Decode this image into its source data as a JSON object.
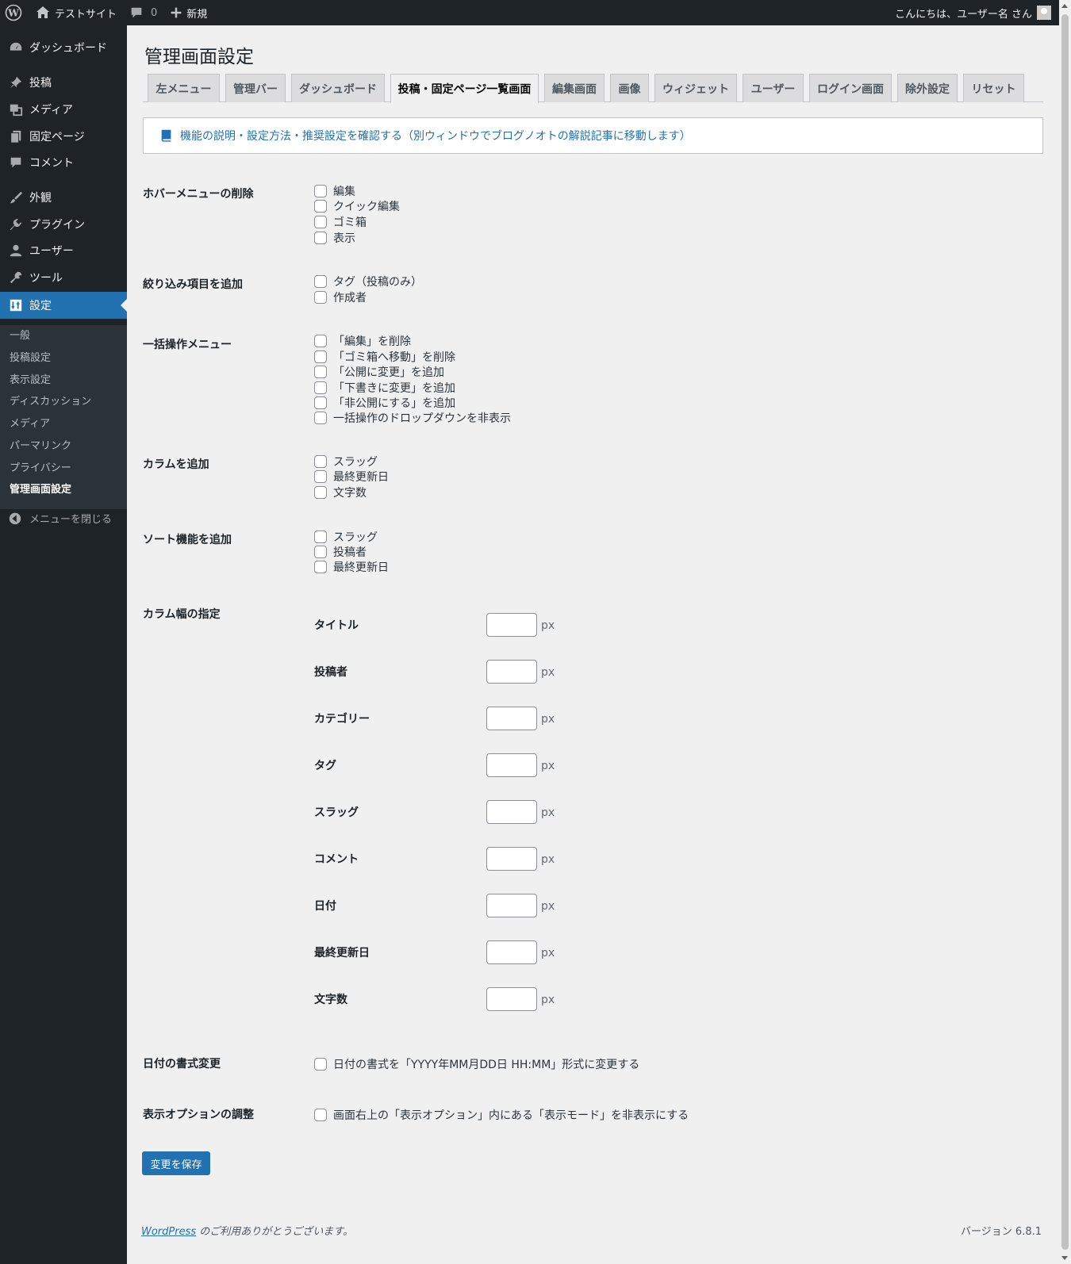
{
  "admin_bar": {
    "site_name": "テストサイト",
    "comments_count": "0",
    "new_label": "新規",
    "greeting": "こんにちは、ユーザー名 さん"
  },
  "sidebar": {
    "items": [
      {
        "label": "ダッシュボード",
        "icon": "dashboard-icon"
      },
      {
        "label": "投稿",
        "icon": "pin-icon"
      },
      {
        "label": "メディア",
        "icon": "media-icon"
      },
      {
        "label": "固定ページ",
        "icon": "page-icon"
      },
      {
        "label": "コメント",
        "icon": "comment-icon"
      },
      {
        "label": "外観",
        "icon": "brush-icon"
      },
      {
        "label": "プラグイン",
        "icon": "plugin-icon"
      },
      {
        "label": "ユーザー",
        "icon": "user-icon"
      },
      {
        "label": "ツール",
        "icon": "wrench-icon"
      },
      {
        "label": "設定",
        "icon": "settings-icon"
      }
    ],
    "submenu": [
      "一般",
      "投稿設定",
      "表示設定",
      "ディスカッション",
      "メディア",
      "パーマリンク",
      "プライバシー",
      "管理画面設定"
    ],
    "collapse_label": "メニューを閉じる"
  },
  "page": {
    "title": "管理画面設定",
    "tabs": [
      "左メニュー",
      "管理バー",
      "ダッシュボード",
      "投稿・固定ページ一覧画面",
      "編集画面",
      "画像",
      "ウィジェット",
      "ユーザー",
      "ログイン画面",
      "除外設定",
      "リセット"
    ],
    "active_tab": "投稿・固定ページ一覧画面",
    "notice_link": "機能の説明・設定方法・推奨設定を確認する（別ウィンドウでブログノオトの解説記事に移動します）"
  },
  "sections": {
    "hover_menu": {
      "label": "ホバーメニューの削除",
      "options": [
        "編集",
        "クイック編集",
        "ゴミ箱",
        "表示"
      ]
    },
    "filter": {
      "label": "絞り込み項目を追加",
      "options": [
        "タグ（投稿のみ）",
        "作成者"
      ]
    },
    "bulk": {
      "label": "一括操作メニュー",
      "options": [
        "「編集」を削除",
        "「ゴミ箱へ移動」を削除",
        "「公開に変更」を追加",
        "「下書きに変更」を追加",
        "「非公開にする」を追加",
        "一括操作のドロップダウンを非表示"
      ]
    },
    "columns": {
      "label": "カラムを追加",
      "options": [
        "スラッグ",
        "最終更新日",
        "文字数"
      ]
    },
    "sort": {
      "label": "ソート機能を追加",
      "options": [
        "スラッグ",
        "投稿者",
        "最終更新日"
      ]
    },
    "widths": {
      "label": "カラム幅の指定",
      "unit": "px",
      "fields": [
        "タイトル",
        "投稿者",
        "カテゴリー",
        "タグ",
        "スラッグ",
        "コメント",
        "日付",
        "最終更新日",
        "文字数"
      ]
    },
    "date_format": {
      "label": "日付の書式変更",
      "option": "日付の書式を「YYYY年MM月DD日 HH:MM」形式に変更する"
    },
    "screen_options": {
      "label": "表示オプションの調整",
      "option": "画面右上の「表示オプション」内にある「表示モード」を非表示にする"
    }
  },
  "save_label": "変更を保存",
  "footer": {
    "wordpress_link": "WordPress",
    "thanks_text": " のご利用ありがとうございます。",
    "version": "バージョン 6.8.1"
  },
  "colors": {
    "accent": "#2271b1",
    "adminbar": "#1d2327",
    "background": "#f0f0f1"
  }
}
